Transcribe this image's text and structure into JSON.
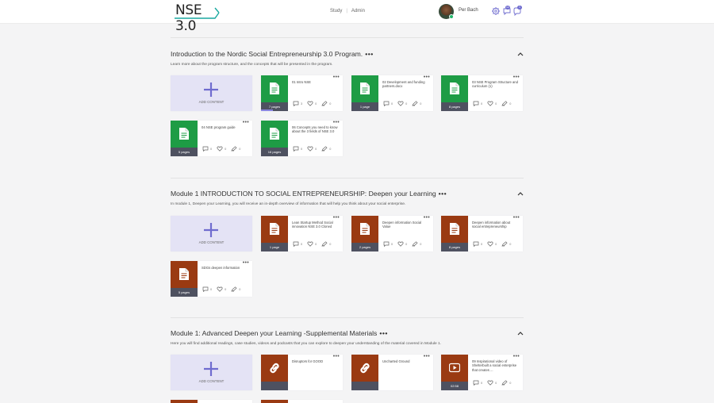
{
  "header": {
    "logo_text": "NSE 3.0",
    "nav": [
      "Study",
      "Admin"
    ],
    "user_name": "Per Bach",
    "notifications_badge": "12",
    "messages_badge": "1",
    "colors": {
      "logo_accent": "#1aa9a0",
      "badge": "#6f6ccf"
    }
  },
  "icons": {
    "doc": "document-icon",
    "link": "link-icon",
    "video": "video-play-icon",
    "comment": "comment-icon",
    "like": "heart-icon",
    "share": "share-icon"
  },
  "add_content_label": "ADD CONTENT",
  "sections": [
    {
      "title": "Introduction to the Nordic Social Entrepreneurship 3.0 Program.",
      "dots": "•••",
      "description": "Learn more about the program structure, and the concepts that will be presented in the program.",
      "cards": [
        {
          "title": "01 Intro NSE",
          "type": "doc",
          "color": "#1e9c45",
          "pages": "7 pages",
          "comments": "3",
          "likes": "0",
          "shares": "0",
          "progress": 0.45
        },
        {
          "title": "02 Development and funding partners.docx",
          "type": "doc",
          "color": "#1e9c45",
          "pages": "1 page",
          "comments": "0",
          "likes": "0",
          "shares": "0",
          "progress": 0
        },
        {
          "title": "03 NSE Program Structure and curriculum (1)",
          "type": "doc",
          "color": "#1e9c45",
          "pages": "8 pages",
          "comments": "0",
          "likes": "0",
          "shares": "0",
          "progress": 0
        },
        {
          "title": "04 NSE program guide",
          "type": "doc",
          "color": "#1e9c45",
          "pages": "5 pages",
          "comments": "0",
          "likes": "0",
          "shares": "0",
          "progress": 0
        },
        {
          "title": "06 Concepts you need to know about the 3 fields of NSE 3.0",
          "type": "doc",
          "color": "#1e9c45",
          "pages": "16 pages",
          "comments": "0",
          "likes": "0",
          "shares": "0",
          "progress": 0
        }
      ]
    },
    {
      "title": "Module 1 INTRODUCTION TO SOCIAL ENTREPRENEURSHIP: Deepen your Learning",
      "dots": "•••",
      "description": "In module 1, Deepen your Learning, you will receive an in-depth overview of information that will help you think about your social enterprise.",
      "cards": [
        {
          "title": "Lean Startup Method Social innovation NSE 3.0 Cloned",
          "type": "doc",
          "color": "#9a3a12",
          "pages": "1 page",
          "comments": "0",
          "likes": "0",
          "shares": "0",
          "progress": 0
        },
        {
          "title": "Deepen information Social Value",
          "type": "doc",
          "color": "#9a3a12",
          "pages": "2 pages",
          "comments": "0",
          "likes": "0",
          "shares": "0",
          "progress": 0
        },
        {
          "title": "Deepen information about social entrepreneurship",
          "type": "doc",
          "color": "#9a3a12",
          "pages": "8 pages",
          "comments": "0",
          "likes": "0",
          "shares": "0",
          "progress": 0
        },
        {
          "title": "SDGs deepen information",
          "type": "doc",
          "color": "#9a3a12",
          "pages": "5 pages",
          "comments": "0",
          "likes": "0",
          "shares": "0",
          "progress": 0
        }
      ]
    },
    {
      "title": "Module 1: Advanced Deepen your Learning -Supplemental Materials",
      "dots": "•••",
      "description": "Here you will find additional readings, case studies, videos and podcasts that you can explore to deepen your understanding of the material covered in Module 1.",
      "cards": [
        {
          "title": "Disruptors for GOOD",
          "type": "link",
          "color": "#9a3a12",
          "pages": "",
          "comments": "",
          "likes": "",
          "shares": "",
          "progress": 0,
          "no_stats": true
        },
        {
          "title": "Uncharted Ground",
          "type": "link",
          "color": "#9a3a12",
          "pages": "",
          "comments": "",
          "likes": "",
          "shares": "",
          "progress": 0,
          "no_stats": true
        },
        {
          "title": "09 Inspirational video of Shelterbuilt a social enterprise that creates ...",
          "type": "video",
          "color": "#9a3a12",
          "pages": "02:58",
          "comments": "0",
          "likes": "0",
          "shares": "0",
          "progress": 0
        }
      ]
    }
  ]
}
